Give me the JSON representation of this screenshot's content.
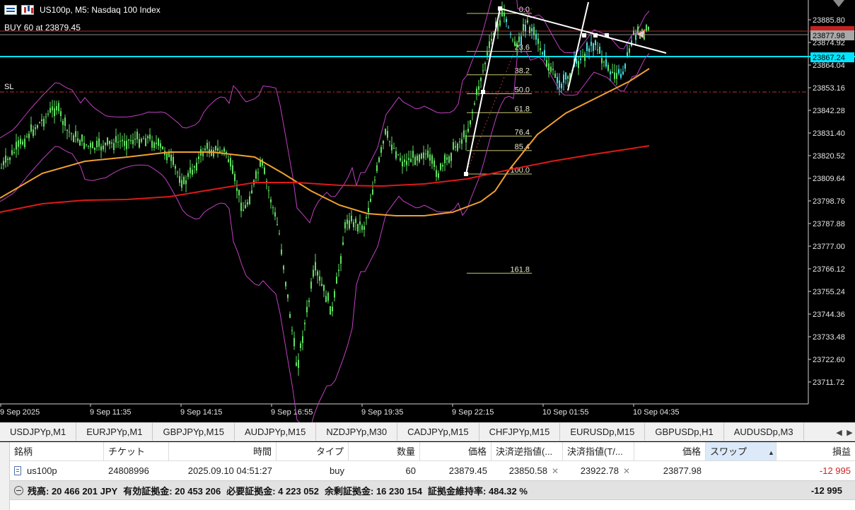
{
  "header": {
    "symbol_title": "US100p, M5:  Nasdaq 100 Index",
    "buy_label": "BUY 60 at 23879.45",
    "sl_label": "SL"
  },
  "chart": {
    "price_axis": [
      "23885.80",
      "23874.92",
      "23864.04",
      "23853.16",
      "23842.28",
      "23831.40",
      "23820.52",
      "23809.64",
      "23798.76",
      "23787.88",
      "23777.00",
      "23766.12",
      "23755.24",
      "23744.36",
      "23733.48",
      "23722.60",
      "23711.72"
    ],
    "time_axis": [
      "9 Sep 2025",
      "9 Sep 11:35",
      "9 Sep 14:15",
      "9 Sep 16:55",
      "9 Sep 19:35",
      "9 Sep 22:15",
      "10 Sep 01:55",
      "10 Sep 04:35"
    ],
    "current_price_label": "23877.98",
    "line_price_label": "23867.24",
    "fib_levels": [
      {
        "label": "0.0",
        "value": 0.0
      },
      {
        "label": "23.6",
        "value": 23.6
      },
      {
        "label": "38.2",
        "value": 38.2
      },
      {
        "label": "50.0",
        "value": 50.0
      },
      {
        "label": "61.8",
        "value": 61.8
      },
      {
        "label": "76.4",
        "value": 76.4
      },
      {
        "label": "85.4",
        "value": 85.4
      },
      {
        "label": "100.0",
        "value": 100.0
      },
      {
        "label": "161.8",
        "value": 161.8
      }
    ],
    "colors": {
      "candle": "#5fe05f",
      "ma_fast": "#f0a030",
      "ma_slow": "#e01818",
      "bands": "#c040c0",
      "cyan_line": "#00e5ff",
      "sl_line": "#c03030",
      "fib": "#c8c870"
    }
  },
  "tabs": [
    "USDJPYp,M1",
    "EURJPYp,M1",
    "GBPJPYp,M15",
    "AUDJPYp,M15",
    "NZDJPYp,M30",
    "CADJPYp,M15",
    "CHFJPYp,M15",
    "EURUSDp,M15",
    "GBPUSDp,H1",
    "AUDUSDp,M3"
  ],
  "terminal": {
    "columns": [
      "銘柄",
      "チケット",
      "時間",
      "タイプ",
      "数量",
      "価格",
      "決済逆指値(...",
      "決済指値(T/...",
      "価格",
      "スワップ",
      "損益"
    ],
    "position": {
      "symbol": "us100p",
      "ticket": "24808996",
      "time": "2025.09.10 04:51:27",
      "type": "buy",
      "volume": "60",
      "open_price": "23879.45",
      "sl": "23850.58",
      "tp": "23922.78",
      "price": "23877.98",
      "swap": "",
      "profit": "-12 995"
    },
    "balance": {
      "balance": "残高: 20 466 201 JPY",
      "equity": "有効証拠金: 20 453 206",
      "margin": "必要証拠金: 4 223 052",
      "free_margin": "余剰証拠金: 16 230 154",
      "margin_level": "証拠金維持率: 484.32 %",
      "total": "-12 995"
    }
  }
}
